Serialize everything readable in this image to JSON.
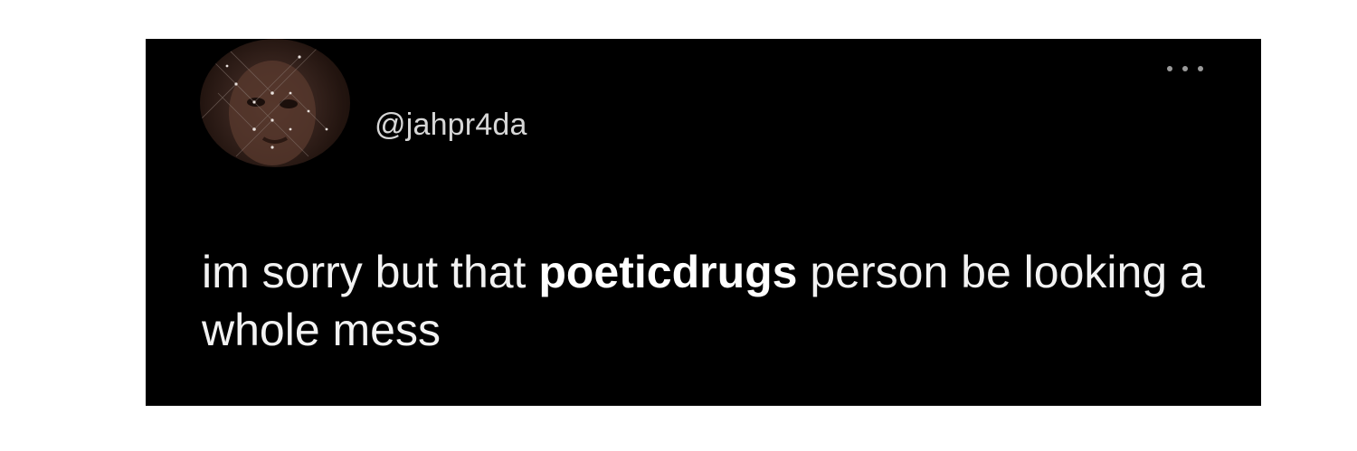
{
  "tweet": {
    "handle": "@jahpr4da",
    "text_before": "im sorry but that ",
    "text_bold": "poeticdrugs",
    "text_after": " person be looking a whole mess"
  },
  "icons": {
    "avatar": "profile-photo",
    "more": "more-options-icon"
  },
  "colors": {
    "card_background": "#000000",
    "page_background": "#ffffff",
    "text": "#f2f2f2",
    "handle": "#d6d6d6"
  }
}
